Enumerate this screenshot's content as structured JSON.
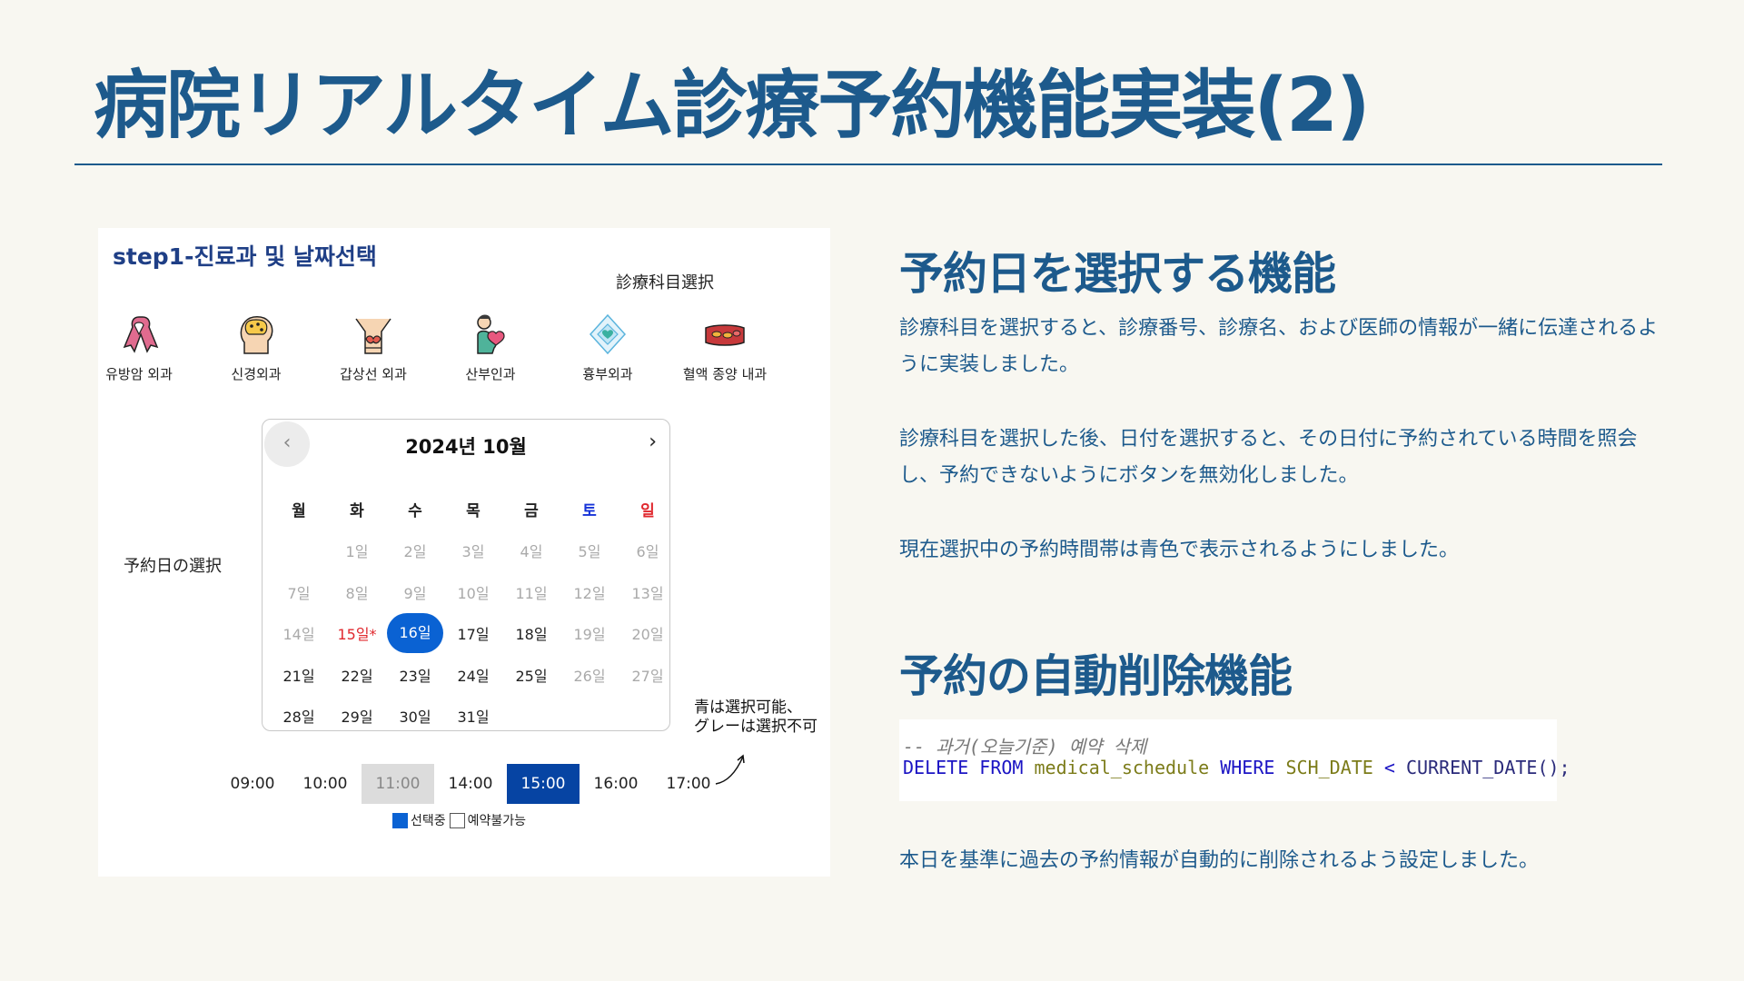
{
  "slide": {
    "title": "病院リアルタイム診療予約機能実装(2)"
  },
  "panel": {
    "step_title": "step1-진료과 및 날짜선택",
    "dept_heading": "診療科目選択",
    "reserve_label": "予約日の選択",
    "departments": [
      {
        "label": "유방암 외과",
        "icon": "ribbon-icon"
      },
      {
        "label": "신경외과",
        "icon": "brain-head-icon"
      },
      {
        "label": "갑상선 외과",
        "icon": "thyroid-neck-icon"
      },
      {
        "label": "산부인과",
        "icon": "pregnant-woman-icon"
      },
      {
        "label": "흉부외과",
        "icon": "heart-diamond-icon"
      },
      {
        "label": "혈액 종양 내과",
        "icon": "blood-vessel-icon"
      }
    ],
    "calendar": {
      "title": "2024년 10월",
      "prev": "‹",
      "next": "›",
      "weekdays": [
        "월",
        "화",
        "수",
        "목",
        "금",
        "토",
        "일"
      ],
      "weeks": [
        [
          "",
          "1일",
          "2일",
          "3일",
          "4일",
          "5일",
          "6일"
        ],
        [
          "7일",
          "8일",
          "9일",
          "10일",
          "11일",
          "12일",
          "13일"
        ],
        [
          "14일",
          "15일*",
          "16일",
          "17일",
          "18일",
          "19일",
          "20일"
        ],
        [
          "21일",
          "22일",
          "23일",
          "24일",
          "25일",
          "26일",
          "27일"
        ],
        [
          "28일",
          "29일",
          "30일",
          "31일",
          "",
          "",
          ""
        ]
      ],
      "selected_day": "16일",
      "holiday_day": "15일*"
    },
    "times": [
      {
        "label": "09:00",
        "state": "available"
      },
      {
        "label": "10:00",
        "state": "available"
      },
      {
        "label": "11:00",
        "state": "unavailable"
      },
      {
        "label": "14:00",
        "state": "available"
      },
      {
        "label": "15:00",
        "state": "selected"
      },
      {
        "label": "16:00",
        "state": "available"
      },
      {
        "label": "17:00",
        "state": "available"
      }
    ],
    "legend": {
      "selected": "선택중",
      "unavailable": "예약불가능"
    },
    "note_line1": "青は選択可能、",
    "note_line2": "グレーは選択不可"
  },
  "right": {
    "section1_title": "予約日を選択する機能",
    "p1": "診療科目を選択すると、診療番号、診療名、および医師の情報が一緒に伝達されるように実装しました。",
    "p2": "診療科目を選択した後、日付を選択すると、その日付に予約されている時間を照会し、予約できないようにボタンを無効化しました。",
    "p3": "現在選択中の予約時間帯は青色で表示されるようにしました。",
    "section2_title": "予約の自動削除機能",
    "code_comment": "-- 과거(오늘기준) 예약 삭제",
    "code": {
      "kw1": "DELETE",
      "kw2": "FROM",
      "table": "medical_schedule",
      "kw3": "WHERE",
      "col": "SCH_DATE",
      "op": "<",
      "fn": "CURRENT_DATE();"
    },
    "p4": "本日を基準に過去の予約情報が自動的に削除されるよう設定しました。"
  },
  "colors": {
    "accent": "#1d5a8c",
    "selected_blue": "#0a62d3",
    "time_selected": "#0644a3",
    "unavailable_gray": "#dcdcdc",
    "background": "#f8f7f1"
  }
}
